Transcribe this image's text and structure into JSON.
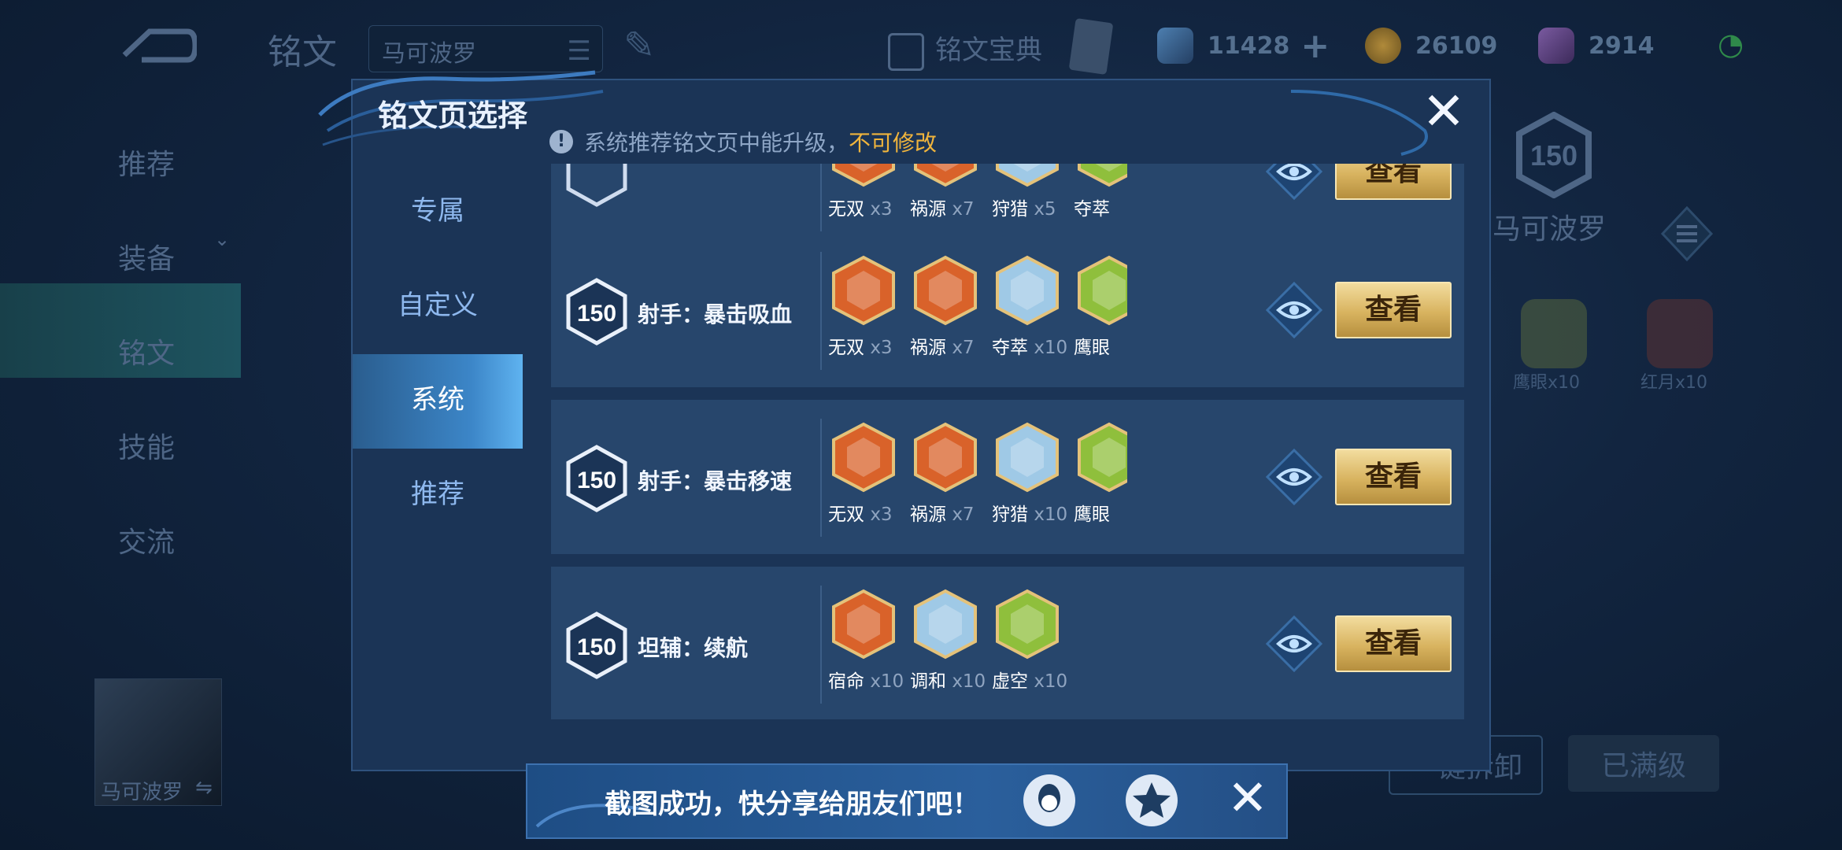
{
  "app": {
    "page_title": "铭文",
    "hero_name": "马可波罗"
  },
  "topbar": {
    "codex_label": "铭文宝典",
    "resources": [
      {
        "name": "diamond-icon",
        "value": "11428",
        "plus": "+"
      },
      {
        "name": "gold-coin-icon",
        "value": "26109"
      },
      {
        "name": "crystal-icon",
        "value": "2914"
      }
    ]
  },
  "nav": {
    "items": [
      "推荐",
      "装备",
      "铭文",
      "技能",
      "交流"
    ],
    "active": "铭文"
  },
  "right_panel": {
    "level": "150",
    "hero_name": "马可波罗",
    "runes": [
      {
        "name": "鹰眼",
        "count": "x10"
      },
      {
        "name": "红月",
        "count": "x10"
      }
    ],
    "buttons": {
      "unload": "一键拆卸",
      "maxed": "已满级"
    }
  },
  "modal": {
    "title": "铭文页选择",
    "notice_text": "系统推荐铭文页中能升级，",
    "notice_warn": "不可修改",
    "tabs": [
      "专属",
      "自定义",
      "系统",
      "推荐"
    ],
    "active_tab": "系统",
    "rows": [
      {
        "level": "",
        "name": "",
        "runes": [
          {
            "name": "无双",
            "count": "x3",
            "color": "red"
          },
          {
            "name": "祸源",
            "count": "x7",
            "color": "red"
          },
          {
            "name": "狩猎",
            "count": "x5",
            "color": "blue"
          },
          {
            "name": "夺萃",
            "count": "",
            "color": "green"
          }
        ],
        "view_label": "查看"
      },
      {
        "level": "150",
        "name": "射手：暴击吸血",
        "runes": [
          {
            "name": "无双",
            "count": "x3",
            "color": "red"
          },
          {
            "name": "祸源",
            "count": "x7",
            "color": "red"
          },
          {
            "name": "夺萃",
            "count": "x10",
            "color": "blue"
          },
          {
            "name": "鹰眼",
            "count": "",
            "color": "green"
          }
        ],
        "view_label": "查看"
      },
      {
        "level": "150",
        "name": "射手：暴击移速",
        "runes": [
          {
            "name": "无双",
            "count": "x3",
            "color": "red"
          },
          {
            "name": "祸源",
            "count": "x7",
            "color": "red"
          },
          {
            "name": "狩猎",
            "count": "x10",
            "color": "blue"
          },
          {
            "name": "鹰眼",
            "count": "",
            "color": "green"
          }
        ],
        "view_label": "查看"
      },
      {
        "level": "150",
        "name": "坦辅：续航",
        "runes": [
          {
            "name": "宿命",
            "count": "x10",
            "color": "red"
          },
          {
            "name": "调和",
            "count": "x10",
            "color": "blue"
          },
          {
            "name": "虚空",
            "count": "x10",
            "color": "green"
          }
        ],
        "view_label": "查看"
      }
    ]
  },
  "toast": {
    "text": "截图成功，快分享给朋友们吧！"
  },
  "colors": {
    "red": "#d9622a",
    "blue": "#9fc9e6",
    "green": "#8fbf3c",
    "gold": "#d8b35f"
  }
}
